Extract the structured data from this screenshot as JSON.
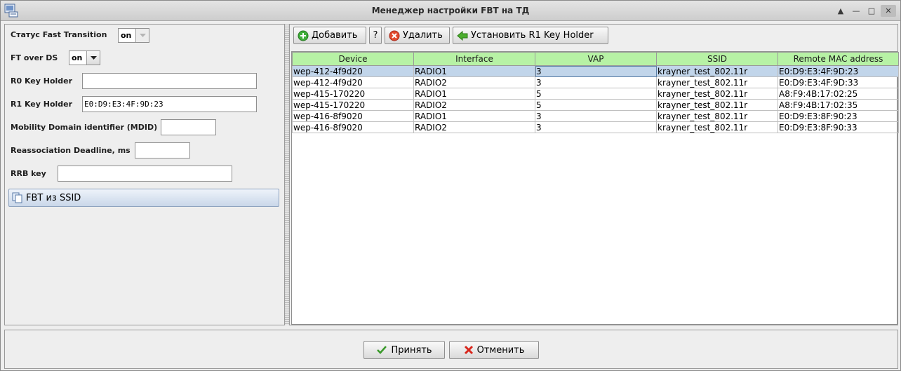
{
  "window": {
    "title": "Менеджер настройки FBT на ТД"
  },
  "left": {
    "fast_transition_label": "Статус Fast Transition",
    "fast_transition_value": "on",
    "ft_over_ds_label": "FT over DS",
    "ft_over_ds_value": "on",
    "r0_label": "R0 Key Holder",
    "r0_value": "",
    "r1_label": "R1 Key Holder",
    "r1_value": "E0:D9:E3:4F:9D:23",
    "mdid_label": "Mobility Domain identifier (MDID)",
    "mdid_value": "",
    "deadline_label": "Reassociation Deadline, ms",
    "deadline_value": "",
    "rrb_label": "RRB key",
    "rrb_value": "",
    "fbt_ssid_button": "FBT из SSID"
  },
  "toolbar": {
    "add_label": "Добавить",
    "help_label": "?",
    "delete_label": "Удалить",
    "set_r1_label": "Установить R1 Key Holder"
  },
  "table": {
    "columns": [
      "Device",
      "Interface",
      "VAP",
      "SSID",
      "Remote MAC address"
    ],
    "rows": [
      {
        "device": "wep-412-4f9d20",
        "interface": "RADIO1",
        "vap": "3",
        "ssid": "krayner_test_802.11r",
        "mac": "E0:D9:E3:4F:9D:23"
      },
      {
        "device": "wep-412-4f9d20",
        "interface": "RADIO2",
        "vap": "3",
        "ssid": "krayner_test_802.11r",
        "mac": "E0:D9:E3:4F:9D:33"
      },
      {
        "device": "wep-415-170220",
        "interface": "RADIO1",
        "vap": "5",
        "ssid": "krayner_test_802.11r",
        "mac": "A8:F9:4B:17:02:25"
      },
      {
        "device": "wep-415-170220",
        "interface": "RADIO2",
        "vap": "5",
        "ssid": "krayner_test_802.11r",
        "mac": "A8:F9:4B:17:02:35"
      },
      {
        "device": "wep-416-8f9020",
        "interface": "RADIO1",
        "vap": "3",
        "ssid": "krayner_test_802.11r",
        "mac": "E0:D9:E3:8F:90:23"
      },
      {
        "device": "wep-416-8f9020",
        "interface": "RADIO2",
        "vap": "3",
        "ssid": "krayner_test_802.11r",
        "mac": "E0:D9:E3:8F:90:33"
      }
    ]
  },
  "footer": {
    "accept_label": "Принять",
    "cancel_label": "Отменить"
  },
  "colors": {
    "header_green": "#b7f2a5",
    "selected_row": "#c1d5ea"
  },
  "icons": {
    "add": "plus-circle-icon",
    "delete": "x-circle-icon",
    "set_r1": "green-arrow-left-icon",
    "accept": "checkmark-icon",
    "cancel": "red-x-icon",
    "fbt": "copy-pages-icon"
  }
}
